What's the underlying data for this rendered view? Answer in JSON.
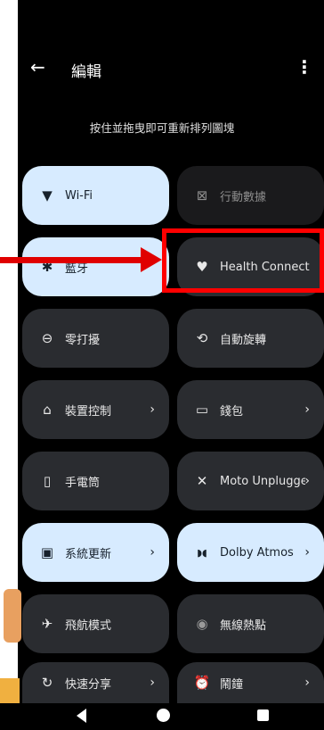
{
  "header": {
    "title": "編輯",
    "back_icon": "←",
    "menu_icon": "⋮"
  },
  "subtitle": "按住並拖曳即可重新排列圖塊",
  "tiles": [
    {
      "label": "Wi-Fi",
      "icon": "▼",
      "state": "on"
    },
    {
      "label": "行動數據",
      "icon": "⊠",
      "state": "off"
    },
    {
      "label": "藍牙",
      "icon": "✱",
      "state": "on"
    },
    {
      "label": "Health Connect",
      "icon": "♥",
      "state": "neutral"
    },
    {
      "label": "零打擾",
      "icon": "⊖",
      "state": "neutral"
    },
    {
      "label": "自動旋轉",
      "icon": "⟲",
      "state": "neutral"
    },
    {
      "label": "裝置控制",
      "icon": "⌂",
      "state": "neutral",
      "chevron": "›"
    },
    {
      "label": "錢包",
      "icon": "▭",
      "state": "neutral",
      "chevron": "›"
    },
    {
      "label": "手電筒",
      "icon": "▯",
      "state": "neutral"
    },
    {
      "label": "Moto Unplugged",
      "icon": "✕",
      "state": "neutral",
      "chevron": "›"
    },
    {
      "label": "系統更新",
      "icon": "▣",
      "state": "on",
      "chevron": "›"
    },
    {
      "label": "Dolby Atmos",
      "icon": "◗◖",
      "state": "on",
      "chevron": "›"
    },
    {
      "label": "飛航模式",
      "icon": "✈",
      "state": "neutral"
    },
    {
      "label": "無線熱點",
      "icon": "◉",
      "state": "neutral"
    },
    {
      "label": "快速分享",
      "icon": "↻",
      "state": "neutral",
      "chevron": "›"
    },
    {
      "label": "鬧鐘",
      "icon": "⏰",
      "state": "neutral",
      "chevron": "›"
    }
  ],
  "navbar": {
    "back": "back",
    "home": "home",
    "recents": "recents"
  },
  "colors": {
    "tile_on": "#d7ebff",
    "tile_neutral": "#2a2c30",
    "highlight": "#ff0000"
  }
}
